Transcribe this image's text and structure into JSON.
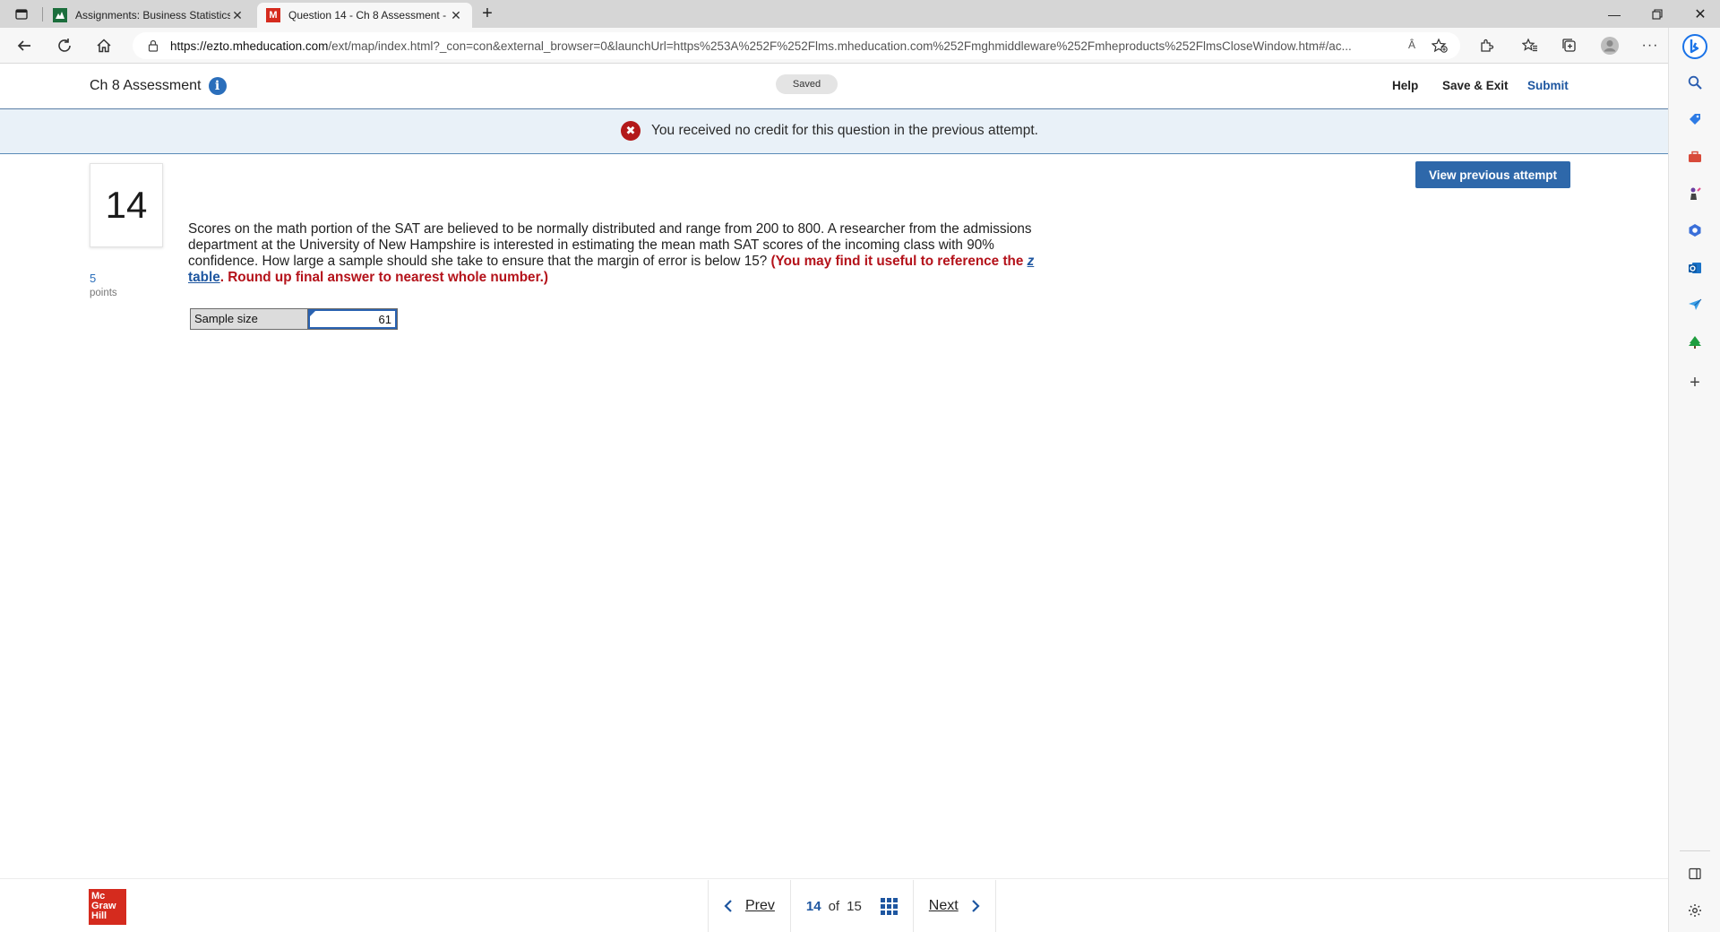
{
  "browser": {
    "tabs": [
      {
        "title": "Assignments: Business Statistics",
        "favicon": "mcgraw-hill-connect-icon"
      },
      {
        "title": "Question 14 - Ch 8 Assessment -",
        "favicon": "mcgraw-hill-m-icon",
        "favicon_letter": "M"
      }
    ],
    "url_host": "https://ezto.mheducation.com",
    "url_rest": "/ext/map/index.html?_con=con&external_browser=0&launchUrl=https%253A%252F%252Flms.mheducation.com%252Fmghmiddleware%252Fmheproducts%252FlmsCloseWindow.htm#/ac...",
    "read_aloud": "Â"
  },
  "header": {
    "title": "Ch 8 Assessment",
    "info_icon": "i",
    "saved": "Saved",
    "help": "Help",
    "save_exit": "Save & Exit",
    "submit": "Submit"
  },
  "notice": {
    "icon": "✖",
    "text": "You received no credit for this question in the previous attempt."
  },
  "question": {
    "number": "14",
    "points": "5",
    "points_label": "points",
    "view_previous": "View previous attempt",
    "text": "Scores on the math portion of the SAT are believed to be normally distributed and range from 200 to 800. A researcher from the admissions department at the University of New Hampshire is interested in estimating the mean math SAT scores of the incoming class with 90% confidence. How large a sample should she take to ensure that the margin of error is below 15?",
    "hint_prefix": "(You may find it useful to reference the ",
    "hint_link_z": "z",
    "hint_link_rest": " table",
    "hint_suffix": ". Round up final answer to nearest whole number.)",
    "answer_label": "Sample size",
    "answer_value": "61"
  },
  "footer": {
    "logo_lines": [
      "Mc",
      "Graw",
      "Hill"
    ],
    "prev": "Prev",
    "current": "14",
    "of": "of",
    "total": "15",
    "next": "Next"
  }
}
